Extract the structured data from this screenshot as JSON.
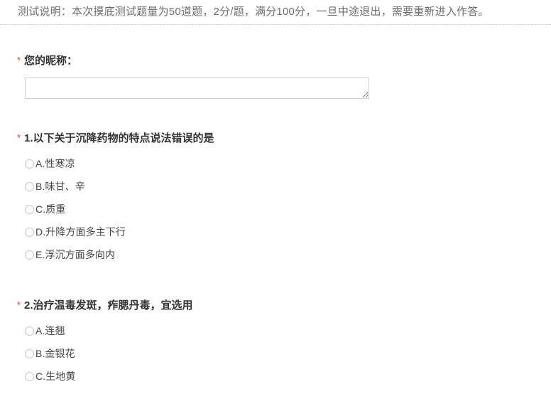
{
  "intro": {
    "text": "测试说明：本次摸底测试题量为50道题，2分/题，满分100分，一旦中途退出，需要重新进入作答。",
    "divider_style": "dashed"
  },
  "colors": {
    "required_star": "#ec3a36",
    "intro_text": "#6d6d6d",
    "question_title": "#343434",
    "option_text": "#454545",
    "input_border": "#cfcfcf",
    "divider": "#d2d2d2",
    "page_background": "#ffffff"
  },
  "nickname_question": {
    "required_marker": "*",
    "title": "您的昵称：",
    "input": {
      "value": "",
      "placeholder": "",
      "resize_handle": "resize-handle-icon"
    }
  },
  "questions": [
    {
      "required_marker": "*",
      "number": "1.",
      "title": "1.以下关于沉降药物的特点说法错误的是",
      "options": [
        {
          "label": "A.性寒凉",
          "selected": false
        },
        {
          "label": "B.味甘、辛",
          "selected": false
        },
        {
          "label": "C.质重",
          "selected": false
        },
        {
          "label": "D.升降方面多主下行",
          "selected": false
        },
        {
          "label": "E.浮沉方面多向内",
          "selected": false
        }
      ]
    },
    {
      "required_marker": "*",
      "number": "2.",
      "title": "2.治疗温毒发斑，痄腮丹毒，宜选用",
      "options": [
        {
          "label": "A.连翘",
          "selected": false
        },
        {
          "label": "B.金银花",
          "selected": false
        },
        {
          "label": "C.生地黄",
          "selected": false
        }
      ]
    }
  ]
}
